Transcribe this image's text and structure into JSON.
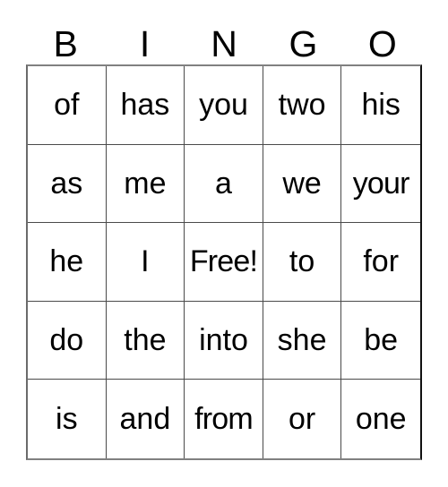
{
  "card": {
    "title_letters": [
      "B",
      "I",
      "N",
      "G",
      "O"
    ],
    "colors": {
      "background": "#ffffff",
      "text": "#000000",
      "grid_line": "#4a4a4a",
      "outer_border": "#808080"
    },
    "grid": {
      "columns": 5,
      "rows": 5,
      "free_space_label": "Free!",
      "free_space_position": {
        "row": 3,
        "column": 3
      },
      "cells": [
        [
          "of",
          "has",
          "you",
          "two",
          "his"
        ],
        [
          "as",
          "me",
          "a",
          "we",
          "your"
        ],
        [
          "he",
          "I",
          "Free!",
          "to",
          "for"
        ],
        [
          "do",
          "the",
          "into",
          "she",
          "be"
        ],
        [
          "is",
          "and",
          "from",
          "or",
          "one"
        ]
      ]
    }
  }
}
